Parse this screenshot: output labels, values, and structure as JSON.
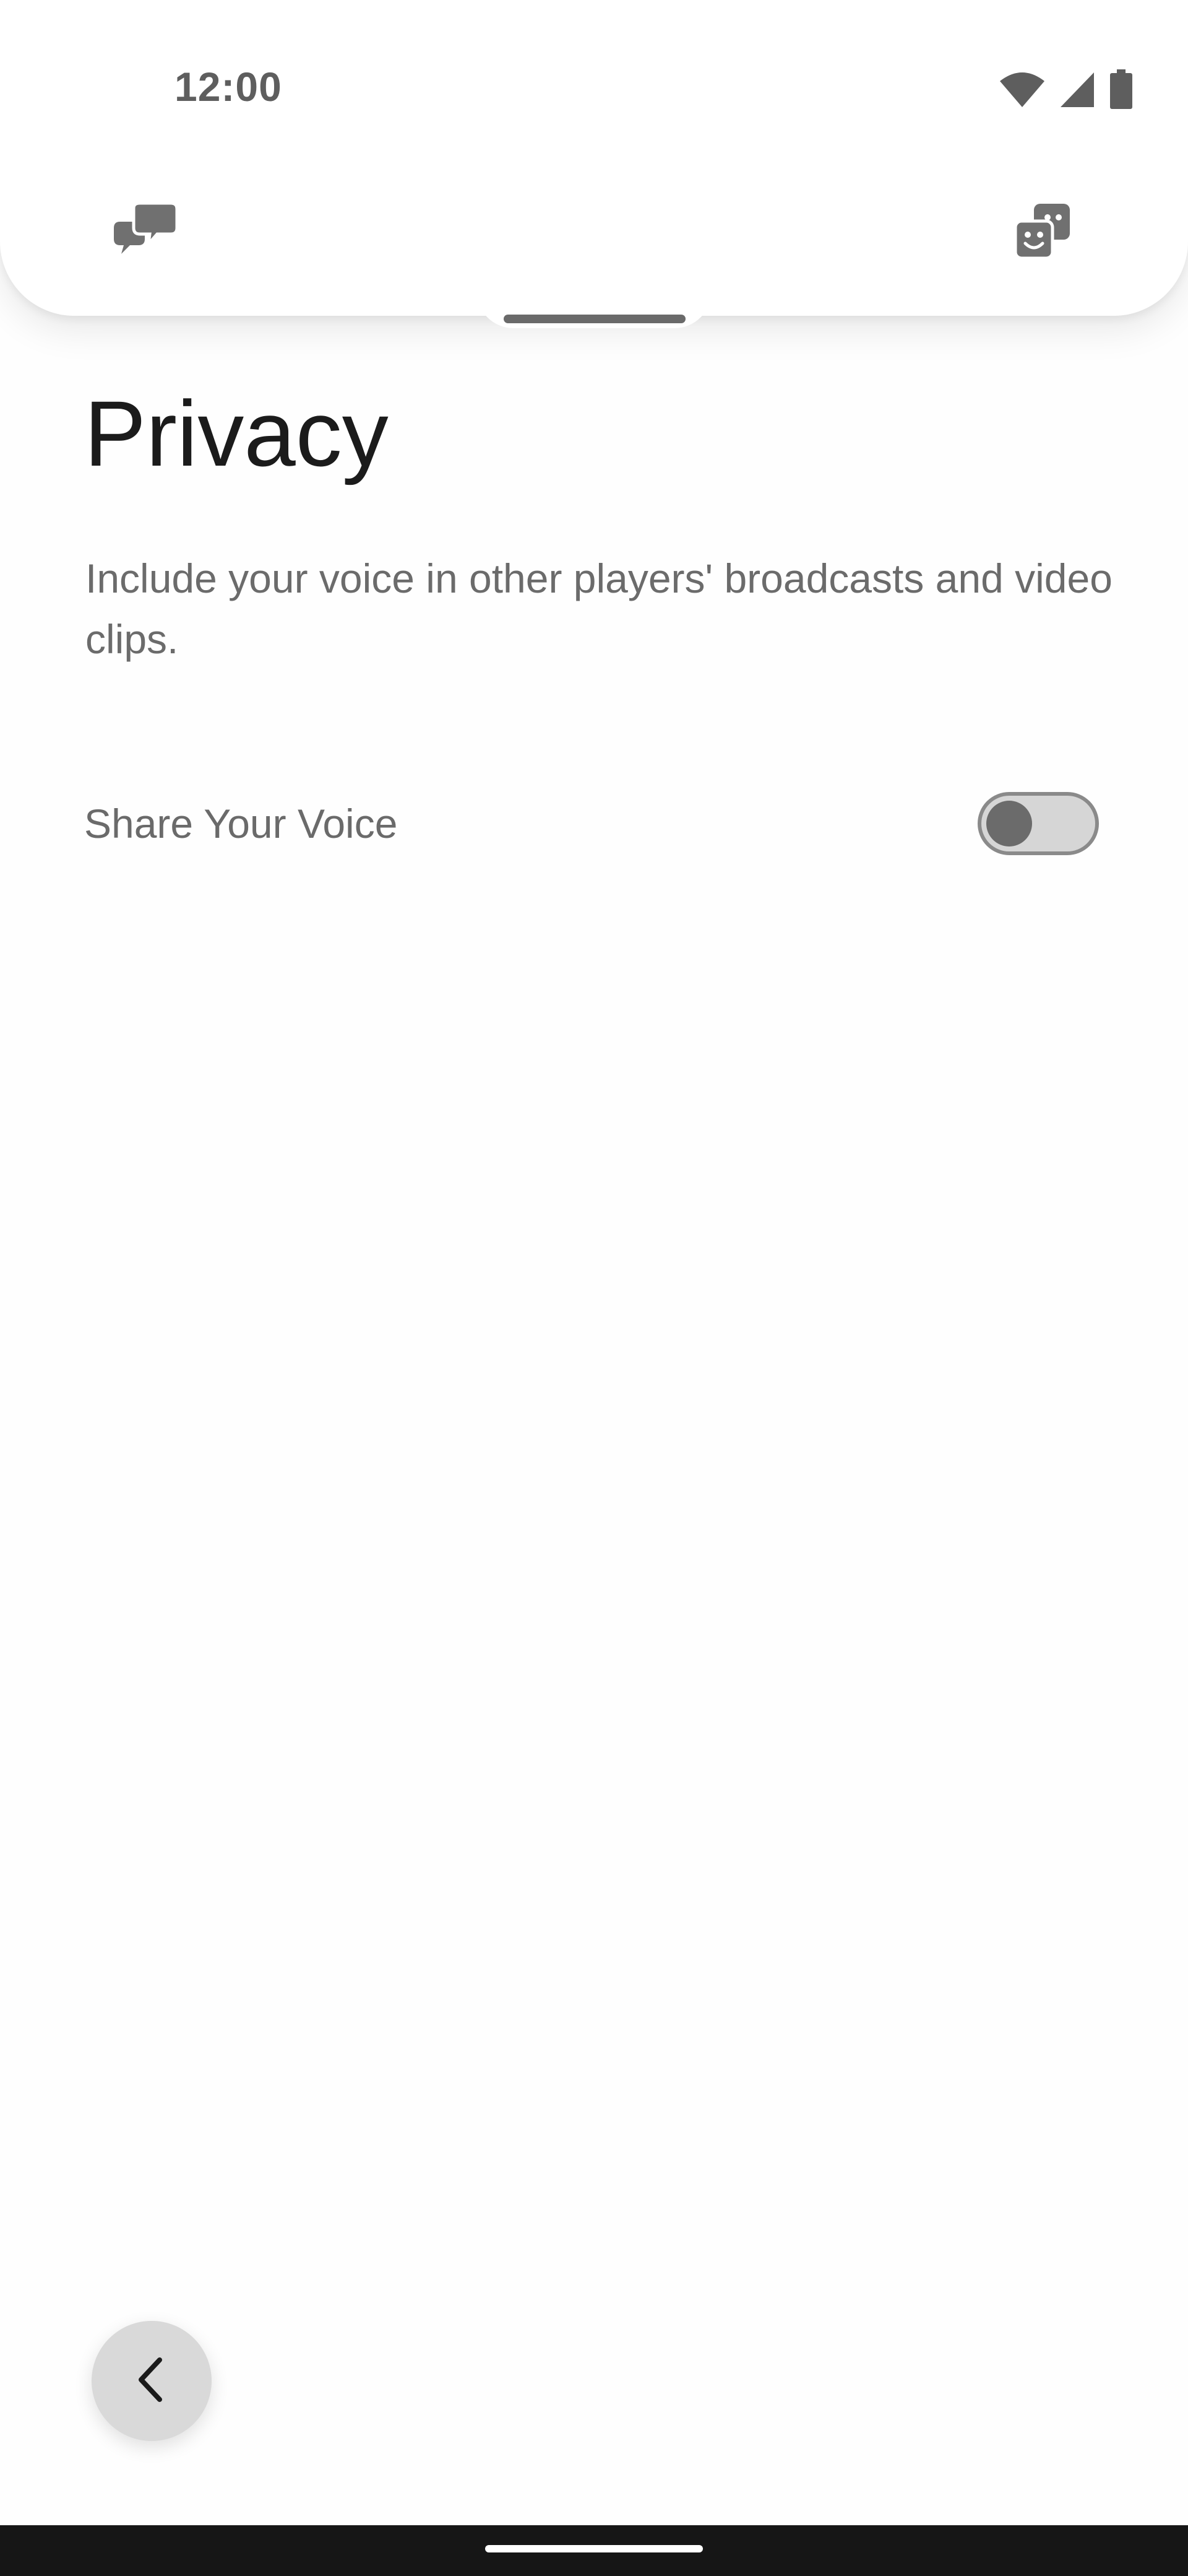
{
  "status_bar": {
    "time": "12:00",
    "icons": [
      "wifi-icon",
      "cellular-signal-icon",
      "battery-icon"
    ]
  },
  "header": {
    "left_icon": "chat-bubbles-icon",
    "right_icon": "party-faces-icon"
  },
  "page": {
    "title": "Privacy",
    "description": "Include your voice in other players' broadcasts and video clips."
  },
  "settings": {
    "share_voice": {
      "label": "Share Your Voice",
      "enabled": false
    }
  },
  "navigation": {
    "back_icon": "chevron-left-icon"
  },
  "colors": {
    "background": "#fefefe",
    "title_text": "#1b1b1b",
    "secondary_text": "#6b6b6b",
    "icon_gray": "#707070",
    "toggle_track": "#d6d6d6",
    "toggle_knob": "#6b6b6b",
    "back_button_bg": "#d9d9d9",
    "nav_bar": "#161616"
  }
}
